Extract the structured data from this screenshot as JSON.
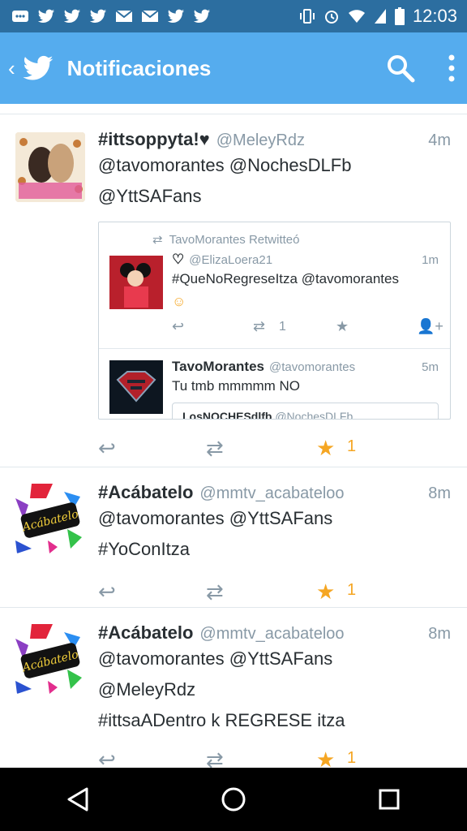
{
  "status_bar": {
    "time": "12:03",
    "notification_icons": [
      "✉",
      "♥",
      "♥",
      "♥",
      "✉",
      "✉",
      "♥",
      "♥",
      "♥"
    ]
  },
  "app_bar": {
    "title": "Notificaciones",
    "back_icon": "‹",
    "search_icon": "search-icon",
    "overflow_icon": "more-vert-icon"
  },
  "tweets": [
    {
      "user": "#ittsoppyta!♥",
      "handle": "@MeleyRdz",
      "time": "4m",
      "text_lines": [
        "@tavomorantes @NochesDLFb",
        "@YttSAFans"
      ],
      "retweet_count": "",
      "fav_count": "1",
      "quote": {
        "rt_label": "TavoMorantes Retwitteó",
        "first": {
          "name_icon": "♡",
          "handle": "@ElizaLoera21",
          "time": "1m",
          "text_lines": [
            "#QueNoRegreseItza @tavomorantes",
            "☺"
          ],
          "retweet_count": "1"
        },
        "second": {
          "name": "TavoMorantes",
          "handle": "@tavomorantes",
          "time": "5m",
          "text": "Tu tmb mmmmm NO",
          "clipped_name": "LosNOCHESdlfb",
          "clipped_handle": "@NochesDLFb"
        }
      }
    },
    {
      "user": "#Acábatelo",
      "handle": "@mmtv_acabateloo",
      "time": "8m",
      "text_lines": [
        "@tavomorantes @YttSAFans",
        "#YoConItza"
      ],
      "fav_count": "1"
    },
    {
      "user": "#Acábatelo",
      "handle": "@mmtv_acabateloo",
      "time": "8m",
      "text_lines": [
        "@tavomorantes @YttSAFans",
        "@MeleyRdz",
        "#ittsaADentro k REGRESE itza"
      ],
      "fav_count": "1"
    }
  ],
  "avatars": {
    "logo_text": "Acábatelo"
  },
  "colors": {
    "status_bar": "#2c6ea0",
    "app_bar": "#55acee",
    "star": "#f5a623",
    "meta": "#8899a6"
  }
}
